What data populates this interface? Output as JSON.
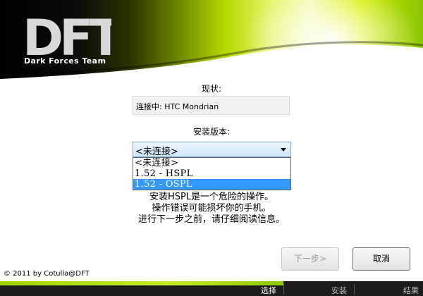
{
  "branding": {
    "logo_text": "DFT",
    "tagline": "Dark Forces Team",
    "copyright": "© 2011 by Cotulla@DFT"
  },
  "status": {
    "label": "现状:",
    "value": "连接中: HTC Mondrian"
  },
  "version": {
    "label": "安装版本:",
    "selected": "<未连接>",
    "options": [
      "<未连接>",
      "1.52 - HSPL",
      "1.52 - OSPL"
    ],
    "highlighted_index": 2
  },
  "warning": {
    "line1": "安装HSPL是一个危险的操作。",
    "line2": "操作错误可能损坏你的手机。",
    "line3": "进行下一步之前，请仔细阅读信息。"
  },
  "buttons": {
    "next": "下一步>",
    "cancel": "取消"
  },
  "steps": {
    "items": [
      "选择",
      "安装",
      "结果"
    ],
    "active_index": 0,
    "progress": 0.67
  },
  "colors": {
    "accent_green": "#a8d600",
    "selection_blue": "#3399ff",
    "banner_dark": "#000000"
  },
  "icons": {
    "dropdown": "chevron-down-icon"
  }
}
